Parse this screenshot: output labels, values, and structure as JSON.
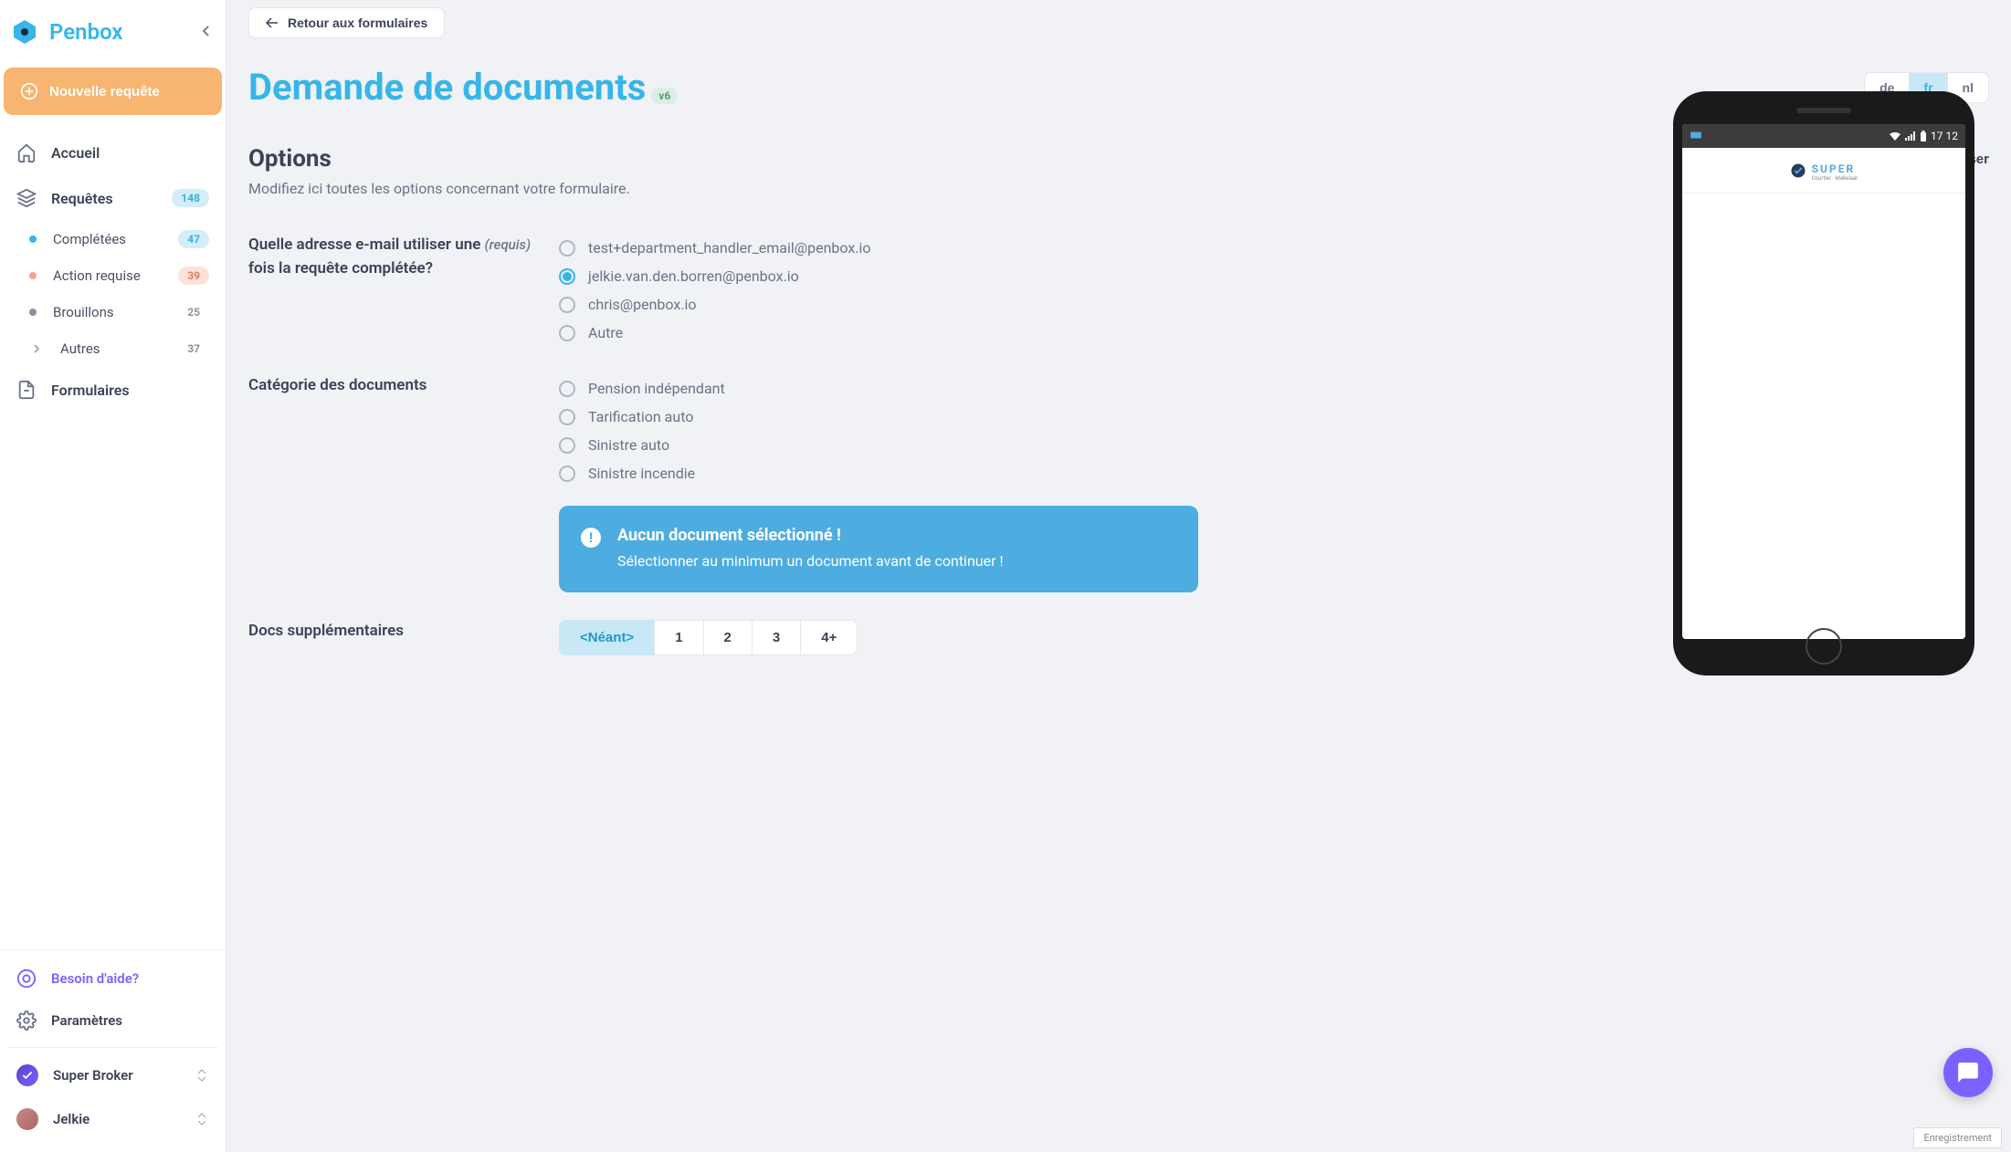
{
  "brand": "Penbox",
  "sidebar": {
    "new_request": "Nouvelle requête",
    "home": "Accueil",
    "requests": {
      "label": "Requêtes",
      "count": "148"
    },
    "completed": {
      "label": "Complétées",
      "count": "47"
    },
    "action": {
      "label": "Action requise",
      "count": "39"
    },
    "drafts": {
      "label": "Brouillons",
      "count": "25"
    },
    "others": {
      "label": "Autres",
      "count": "37"
    },
    "forms": "Formulaires",
    "help": "Besoin d'aide?",
    "settings": "Paramètres",
    "broker": "Super Broker",
    "user": "Jelkie"
  },
  "back": "Retour aux formulaires",
  "title": "Demande de documents",
  "version": "v6",
  "langs": {
    "de": "de",
    "fr": "fr",
    "nl": "nl",
    "active": "fr"
  },
  "section": {
    "title": "Options",
    "sub": "Modifiez ici toutes les options concernant votre formulaire.",
    "reset": "Réinitialiser"
  },
  "email_q": {
    "label_line1": "Quelle adresse e-mail utiliser une",
    "label_line2": "fois la requête complétée?",
    "required": "(requis)",
    "options": [
      "test+department_handler_email@penbox.io",
      "jelkie.van.den.borren@penbox.io",
      "chris@penbox.io",
      "Autre"
    ],
    "selected": 1
  },
  "category_q": {
    "label": "Catégorie des documents",
    "options": [
      "Pension indépendant",
      "Tarification auto",
      "Sinistre auto",
      "Sinistre incendie"
    ]
  },
  "alert": {
    "title": "Aucun document sélectionné !",
    "text": "Sélectionner au minimum un document avant de continuer !"
  },
  "docs_supp": {
    "label": "Docs supplémentaires",
    "options": [
      "<Néant>",
      "1",
      "2",
      "3",
      "4+"
    ],
    "selected": 0
  },
  "phone": {
    "time": "17 12",
    "brand": "SUPER",
    "brand_sub": "Courtier · Makelaar"
  },
  "save_indicator": "Enregistrement"
}
